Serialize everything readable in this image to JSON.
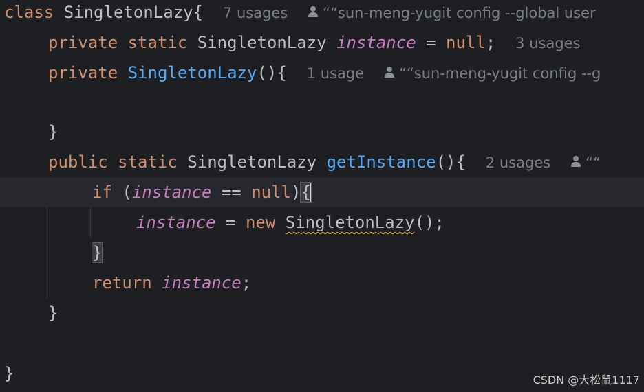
{
  "code": {
    "line1": {
      "kw_class": "class",
      "class_name": " SingletonLazy{",
      "usages": "7 usages",
      "author": "““sun-meng-yugit config --global user"
    },
    "line2": {
      "kw_private": "private",
      "kw_static": "static",
      "type": "SingletonLazy",
      "field": "instance",
      "assign": " = ",
      "kw_null": "null",
      "semi": ";",
      "usages": "3 usages"
    },
    "line3": {
      "kw_private": "private",
      "ctor": "SingletonLazy",
      "parens": "(){",
      "usages": "1 usage",
      "author": "““sun-meng-yugit config --g"
    },
    "line5": {
      "brace": "}"
    },
    "line6": {
      "kw_public": "public",
      "kw_static": "static",
      "type": "SingletonLazy",
      "method": "getInstance",
      "parens": "(){",
      "usages": "2 usages",
      "author": "““"
    },
    "line7": {
      "kw_if": "if",
      "open": " (",
      "field": "instance",
      "op": " == ",
      "kw_null": "null",
      "close": ")",
      "brace": "{"
    },
    "line8": {
      "field": "instance",
      "assign": " = ",
      "kw_new": "new",
      "type": "SingletonLazy",
      "tail": "();"
    },
    "line9": {
      "brace": "}"
    },
    "line10": {
      "kw_return": "return",
      "field": "instance",
      "semi": ";"
    },
    "line11": {
      "brace": "}"
    },
    "line13": {
      "brace": "}"
    }
  },
  "watermark": "CSDN @大松鼠1117",
  "colors": {
    "background": "#1e1f22",
    "keyword": "#cf8e6d",
    "method": "#56a8f5",
    "field": "#c77dbb",
    "text": "#bcbec4",
    "hint": "#7a7e85"
  }
}
